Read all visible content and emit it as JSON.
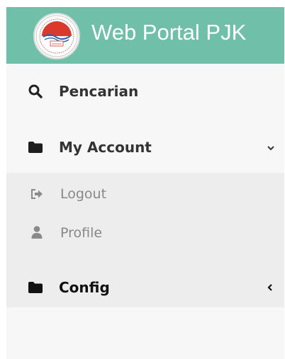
{
  "header": {
    "title": "Web Portal PJK",
    "logo_icon": "seal-emblem-icon",
    "color": "#6fbfa9"
  },
  "menu": {
    "search": {
      "label": "Pencarian",
      "icon": "search-icon"
    },
    "my_account": {
      "label": "My Account",
      "icon": "folder-icon",
      "expanded": true,
      "items": [
        {
          "label": "Logout",
          "icon": "sign-out-icon"
        },
        {
          "label": "Profile",
          "icon": "user-icon"
        }
      ]
    },
    "config": {
      "label": "Config",
      "icon": "folder-icon",
      "expanded": false
    }
  },
  "colors": {
    "sidebar_bg": "#f7f7f7",
    "submenu_bg": "#ededed",
    "main_text": "#333333",
    "sub_text": "#888888"
  }
}
